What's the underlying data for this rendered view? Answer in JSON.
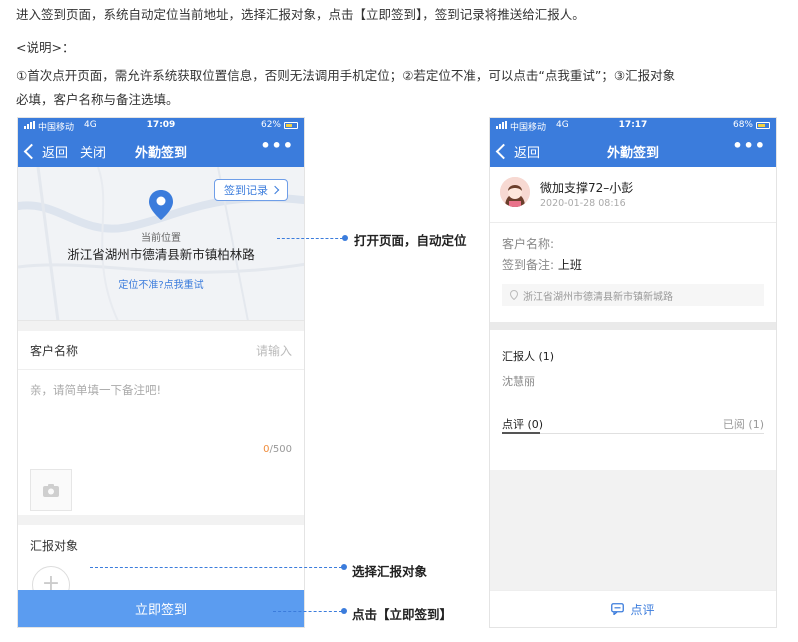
{
  "intro": {
    "line1": "进入签到页面，系统自动定位当前地址，选择汇报对象，点击【立即签到】，签到记录将推送给汇报人。",
    "line2": "<说明>：",
    "line3": "①首次点开页面，需允许系统获取位置信息，否则无法调用手机定位；②若定位不准，可以点击“点我重试”；③汇报对象",
    "line4": "必填，客户名称与备注选填。"
  },
  "phone1": {
    "status": {
      "carrier": "中国移动",
      "network": "4G",
      "time": "17:09",
      "battery": "62%"
    },
    "nav": {
      "back": "返回",
      "close": "关闭",
      "title": "外勤签到",
      "more": "•••"
    },
    "map": {
      "record_button": "签到记录",
      "location_label": "当前位置",
      "address": "浙江省湖州市德清县新市镇柏林路",
      "retry_link": "定位不准?点我重试"
    },
    "customer": {
      "label": "客户名称",
      "placeholder": "请输入"
    },
    "remark": {
      "placeholder": "亲，请简单填一下备注吧!",
      "count_current": "0",
      "count_max": "/500"
    },
    "report": {
      "label": "汇报对象"
    },
    "submit_label": "立即签到"
  },
  "phone2": {
    "status": {
      "carrier": "中国移动",
      "network": "4G",
      "time": "17:17",
      "battery": "68%"
    },
    "nav": {
      "back": "返回",
      "title": "外勤签到",
      "more": "•••"
    },
    "user": {
      "name": "微加支撑72–小彭",
      "date": "2020-01-28 08:16"
    },
    "info": {
      "customer_label": "客户名称:",
      "remark_label": "签到备注:",
      "remark_value": "上班",
      "address": "浙江省湖州市德清县新市镇新城路"
    },
    "reporters": {
      "title": "汇报人 (1)",
      "name": "沈慧丽"
    },
    "tabs": {
      "comments": "点评 (0)",
      "read": "已阅 (1)"
    },
    "comment_button": "点评"
  },
  "callouts": {
    "open": "打开页面，自动定位",
    "choose": "选择汇报对象",
    "click": "点击【立即签到】"
  },
  "colors": {
    "brand_blue": "#3b7cdc",
    "submit_blue": "#5b9cf0",
    "counter_orange": "#f08c3a"
  },
  "battery_levels": {
    "phone1": 0.62,
    "phone2": 0.68
  }
}
